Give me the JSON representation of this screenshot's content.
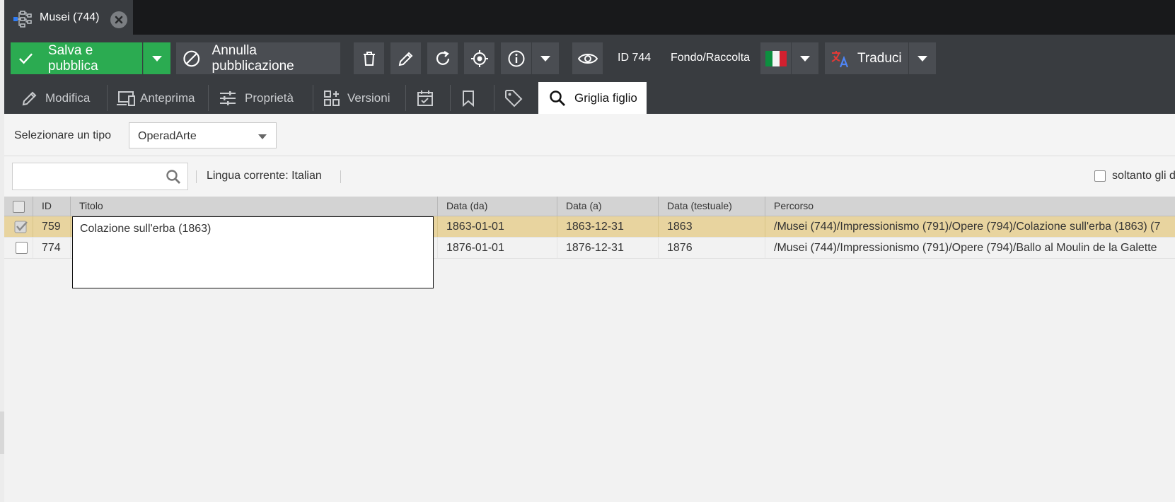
{
  "doc_tab": {
    "title": "Musei (744)",
    "icon": "tree-structure-icon",
    "close_icon": "close-icon"
  },
  "toolbar": {
    "save_label": "Salva e pubblica",
    "unpublish_label": "Annulla pubblicazione",
    "id_label": "ID 744",
    "fondo_label": "Fondo/Raccolta",
    "translate_label": "Traduci",
    "language_flag": "italian-flag-icon"
  },
  "tabs": [
    {
      "label": "Modifica",
      "icon": "pencil-icon"
    },
    {
      "label": "Anteprima",
      "icon": "devices-icon"
    },
    {
      "label": "Proprietà",
      "icon": "sliders-icon"
    },
    {
      "label": "Versioni",
      "icon": "grid-plus-icon"
    },
    {
      "label": "",
      "icon": "calendar-check-icon"
    },
    {
      "label": "",
      "icon": "bookmark-icon"
    },
    {
      "label": "",
      "icon": "tag-icon"
    },
    {
      "label": "Griglia figlio",
      "icon": "search-icon"
    }
  ],
  "type_selector": {
    "label": "Selezionare un tipo",
    "value": "OperadArte"
  },
  "search": {
    "placeholder": "",
    "value": "",
    "language_label": "Lingua corrente: Italian",
    "filter_label": "soltanto gli d"
  },
  "grid": {
    "columns": [
      "ID",
      "Titolo",
      "Data (da)",
      "Data (a)",
      "Data (testuale)",
      "Percorso"
    ],
    "rows": [
      {
        "id": "759",
        "titolo": "Colazione sull'erba (1863)",
        "data_da": "1863-01-01",
        "data_a": "1863-12-31",
        "data_testuale": "1863",
        "percorso": "/Musei (744)/Impressionismo (791)/Opere (794)/Colazione sull'erba (1863) (7",
        "selected": true
      },
      {
        "id": "774",
        "titolo": "",
        "data_da": "1876-01-01",
        "data_a": "1876-12-31",
        "data_testuale": "1876",
        "percorso": "/Musei (744)/Impressionismo (791)/Opere (794)/Ballo al Moulin de la Galette",
        "selected": false
      }
    ],
    "editor_value": "Colazione sull'erba (1863)"
  },
  "colors": {
    "dark_bg": "#393c40",
    "topbar_bg": "#18191b",
    "green": "#2bab51",
    "selected_row": "#e8d49f",
    "grid_header": "#d3d3d3"
  }
}
